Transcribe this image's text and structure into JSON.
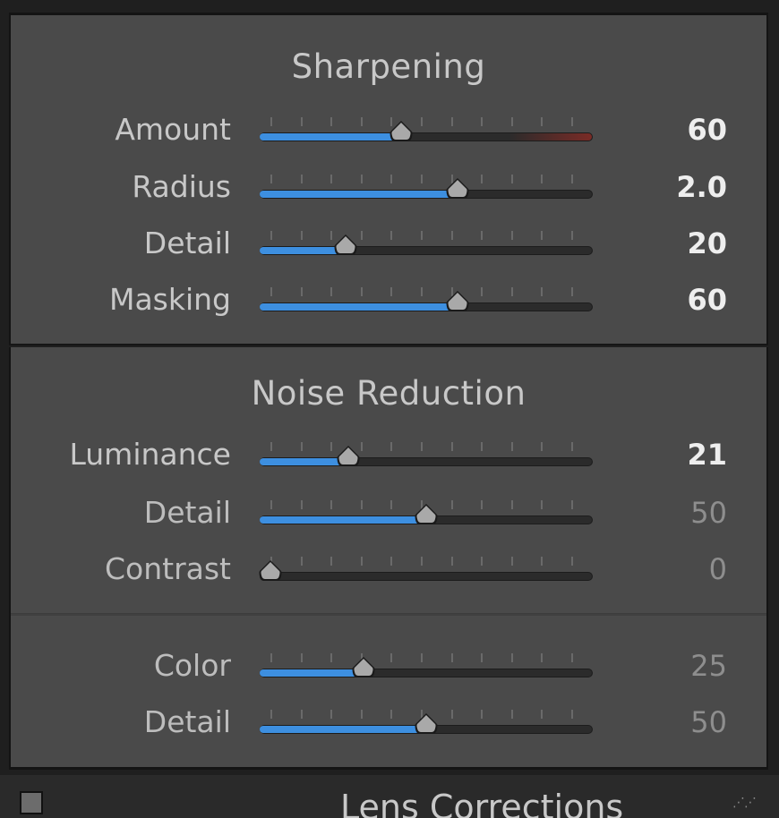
{
  "sharpening": {
    "title": "Sharpening",
    "sliders": [
      {
        "label": "Amount",
        "value_text": "60",
        "fraction": 0.42,
        "dim": false,
        "warn": true
      },
      {
        "label": "Radius",
        "value_text": "2.0",
        "fraction": 0.6,
        "dim": false,
        "warn": false
      },
      {
        "label": "Detail",
        "value_text": "20",
        "fraction": 0.24,
        "dim": false,
        "warn": false
      },
      {
        "label": "Masking",
        "value_text": "60",
        "fraction": 0.6,
        "dim": false,
        "warn": false
      }
    ]
  },
  "noise_reduction": {
    "title": "Noise Reduction",
    "sliders": [
      {
        "label": "Luminance",
        "value_text": "21",
        "fraction": 0.25,
        "dim": false,
        "warn": false
      },
      {
        "label": "Detail",
        "value_text": "50",
        "fraction": 0.5,
        "dim": true,
        "warn": false
      },
      {
        "label": "Contrast",
        "value_text": "0",
        "fraction": 0.0,
        "dim": true,
        "warn": false
      }
    ],
    "color_sliders": [
      {
        "label": "Color",
        "value_text": "25",
        "fraction": 0.3,
        "dim": true,
        "warn": false
      },
      {
        "label": "Detail",
        "value_text": "50",
        "fraction": 0.5,
        "dim": true,
        "warn": false
      }
    ]
  },
  "lens_corrections": {
    "title": "Lens Corrections"
  },
  "colors": {
    "accent": "#3d8fe0",
    "panel": "#4a4a4a",
    "warn": "#7a2b26"
  }
}
